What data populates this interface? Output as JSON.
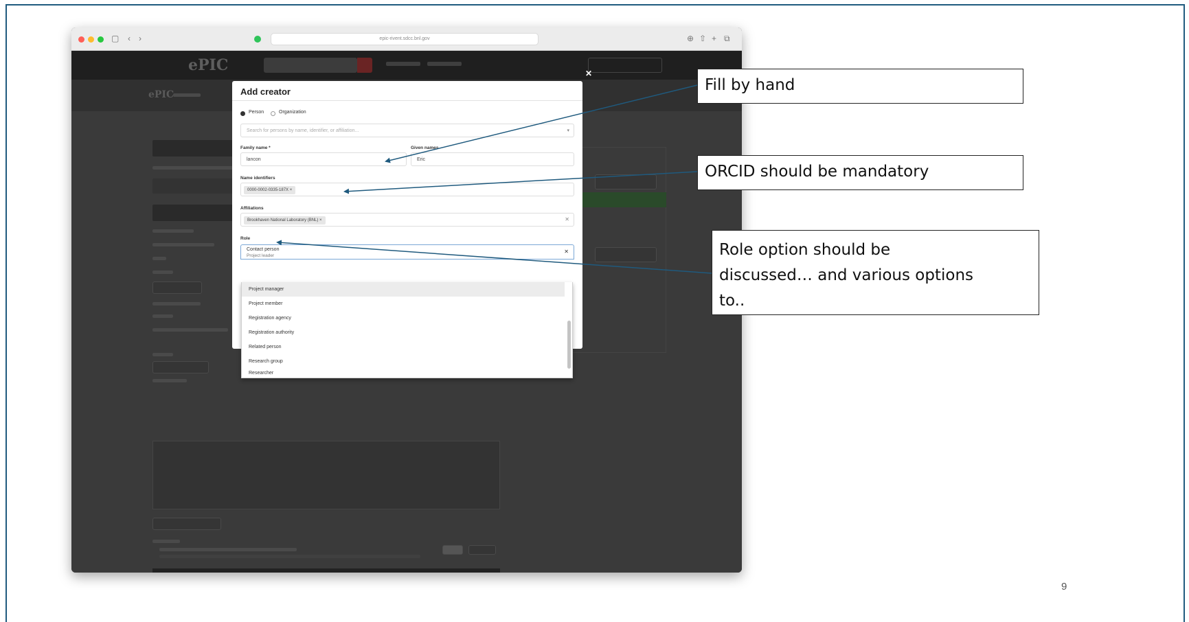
{
  "browser": {
    "url": "epic-rivent.sdcc.bnl.gov"
  },
  "site": {
    "logo": "ePIC",
    "sub_logo": "ePIC"
  },
  "modal": {
    "title": "Add creator",
    "radio_person": "Person",
    "radio_organization": "Organization",
    "search_placeholder": "Search for persons by name, identifier, or affiliation...",
    "family_name_label": "Family name *",
    "family_name_value": "lancon",
    "given_names_label": "Given names",
    "given_names_value": "Eric",
    "identifiers_label": "Name identifiers",
    "identifier_chip": "0000-0002-0335-187X ×",
    "affiliations_label": "Affiliations",
    "affiliation_chip": "Brookhaven National Laboratory (BNL) ×",
    "role_label": "Role",
    "role_selected": "Contact person",
    "role_prev_item": "Project leader",
    "role_options": [
      "Project manager",
      "Project member",
      "Registration agency",
      "Registration authority",
      "Related person",
      "Research group",
      "Researcher"
    ]
  },
  "callouts": {
    "fill_by_hand": "Fill by hand",
    "orcid": "ORCID should be mandatory",
    "role_line1": "Role option should be",
    "role_line2": "discussed… and various options",
    "role_line3": "to.."
  },
  "page_number": "9",
  "colors": {
    "arrow": "#1f5a7e",
    "frame": "#1f5a7e"
  }
}
